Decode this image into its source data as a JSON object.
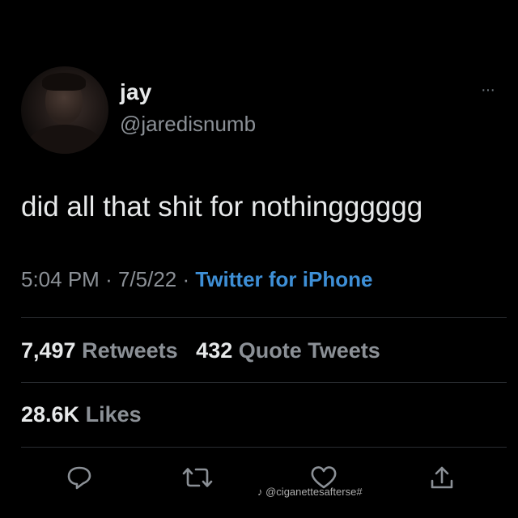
{
  "tweet": {
    "display_name": "jay",
    "handle": "@jaredisnumb",
    "text": "did all that shit for nothingggggg",
    "time": "5:04 PM",
    "date": "7/5/22",
    "source": "Twitter for iPhone",
    "more_icon": "···"
  },
  "stats": {
    "retweets_count": "7,497",
    "retweets_label": "Retweets",
    "quotes_count": "432",
    "quotes_label": "Quote Tweets",
    "likes_count": "28.6K",
    "likes_label": "Likes"
  },
  "actions": {
    "reply_icon": "reply-icon",
    "retweet_icon": "retweet-icon",
    "like_icon": "heart-icon",
    "share_icon": "share-icon"
  },
  "watermark": {
    "text": "♪ @ciganettesafterse#"
  },
  "colors": {
    "background": "#000000",
    "text_primary": "#e7e9ea",
    "text_secondary": "#8b9096",
    "link": "#3e8fd6",
    "divider": "#2a2d31"
  }
}
